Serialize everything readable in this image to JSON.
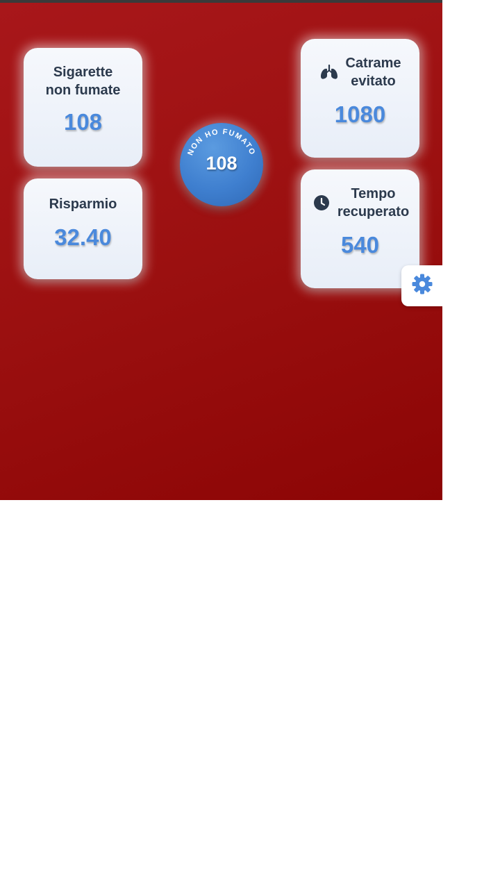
{
  "cards": {
    "sigarette": {
      "title_line1": "Sigarette",
      "title_line2": "non fumate",
      "value": "108"
    },
    "risparmio": {
      "title": "Risparmio",
      "value": "32.40"
    },
    "catrame": {
      "title_line1": "Catrame",
      "title_line2": "evitato",
      "value": "1080",
      "icon": "lungs-icon"
    },
    "tempo": {
      "title_line1": "Tempo",
      "title_line2": "recuperato",
      "value": "540",
      "icon": "clock-icon"
    }
  },
  "counter": {
    "arc_label": "NON HO FUMATO",
    "value": "108"
  },
  "settings": {
    "icon": "gear-icon"
  },
  "colors": {
    "background": "#9b1010",
    "accent": "#4a89dc",
    "card_title": "#2c3a4d",
    "card_bg": "#eef2fa"
  }
}
